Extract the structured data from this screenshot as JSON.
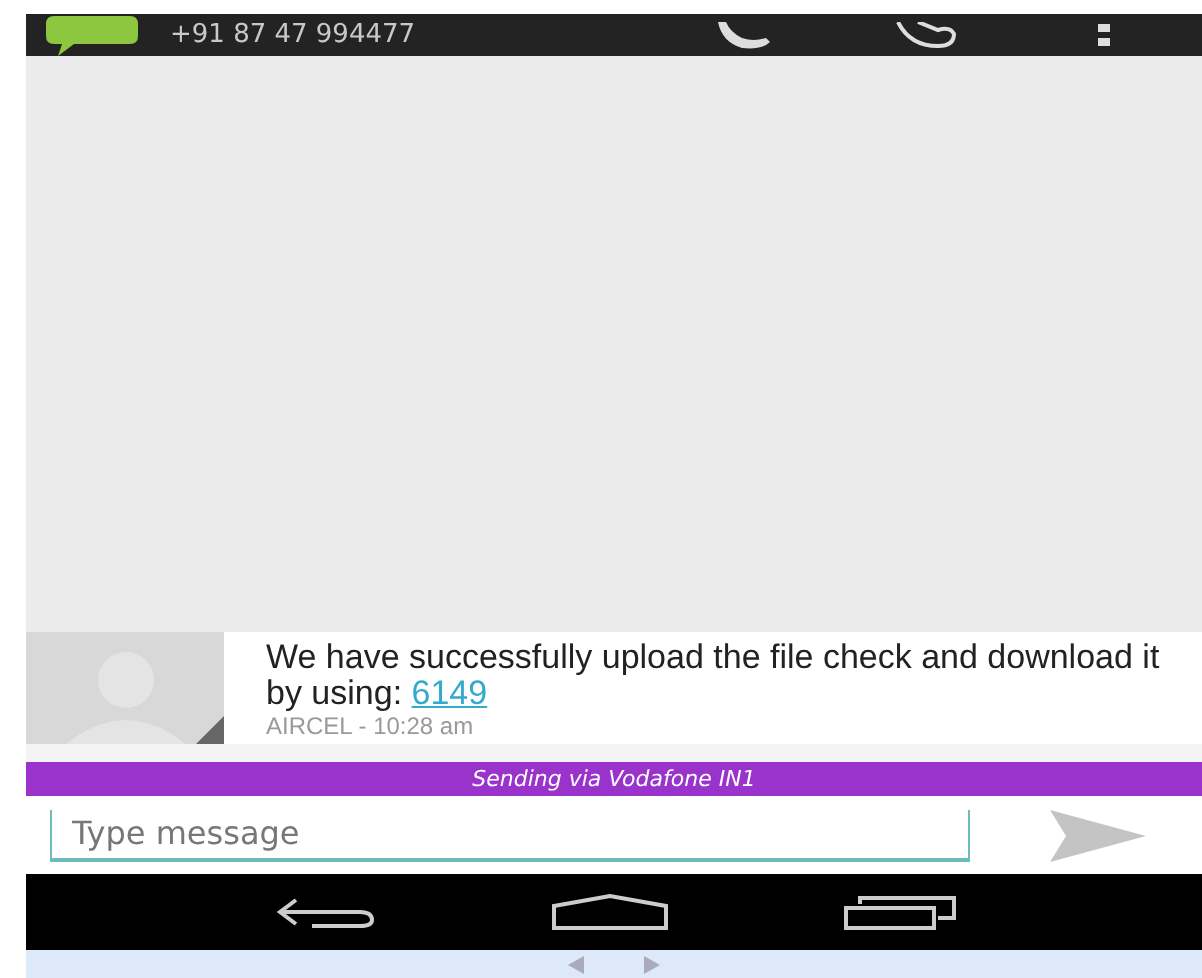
{
  "header": {
    "phone_number": "+91 87 47 994477"
  },
  "message": {
    "text": "We have successfully upload the file check and download it by using:",
    "link": "6149",
    "meta": "AIRCEL - 10:28 am"
  },
  "banner": {
    "text": "Sending via Vodafone IN1"
  },
  "composer": {
    "placeholder": "Type message"
  }
}
